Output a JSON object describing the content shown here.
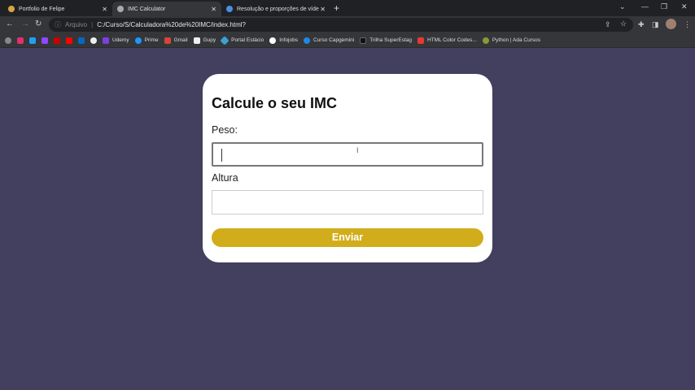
{
  "browser": {
    "tabs": [
      {
        "label": "Portfolio de Felipe"
      },
      {
        "label": "IMC Calculator"
      },
      {
        "label": "Resolução e proporções de víde"
      }
    ],
    "address": {
      "scheme": "Arquivo",
      "url": "C:/Curso/S/Calculadora%20de%20IMC/index.html?"
    },
    "bookmarks": [
      {
        "label": "Udemy",
        "color": "#7b3fe4"
      },
      {
        "label": "Prime",
        "color": "#1a98ff"
      },
      {
        "label": "Gmail",
        "color": "#d44638"
      },
      {
        "label": "Gupy",
        "color": "#eeeeee"
      },
      {
        "label": "Portal Estácio",
        "color": "#3aa0d8"
      },
      {
        "label": "Infojobs",
        "color": "#ffffff"
      },
      {
        "label": "Curso Capgemini",
        "color": "#1e88e5"
      },
      {
        "label": "Trilha SuperEstag",
        "color": "#111111"
      },
      {
        "label": "HTML Color Codes...",
        "color": "#e53935"
      },
      {
        "label": "Python | Ada Cursos",
        "color": "#8a9a3a"
      }
    ]
  },
  "form": {
    "title": "Calcule o seu IMC",
    "peso_label": "Peso:",
    "peso_value": "",
    "altura_label": "Altura",
    "altura_value": "",
    "submit_label": "Enviar",
    "accent": "#d1ad1b"
  }
}
